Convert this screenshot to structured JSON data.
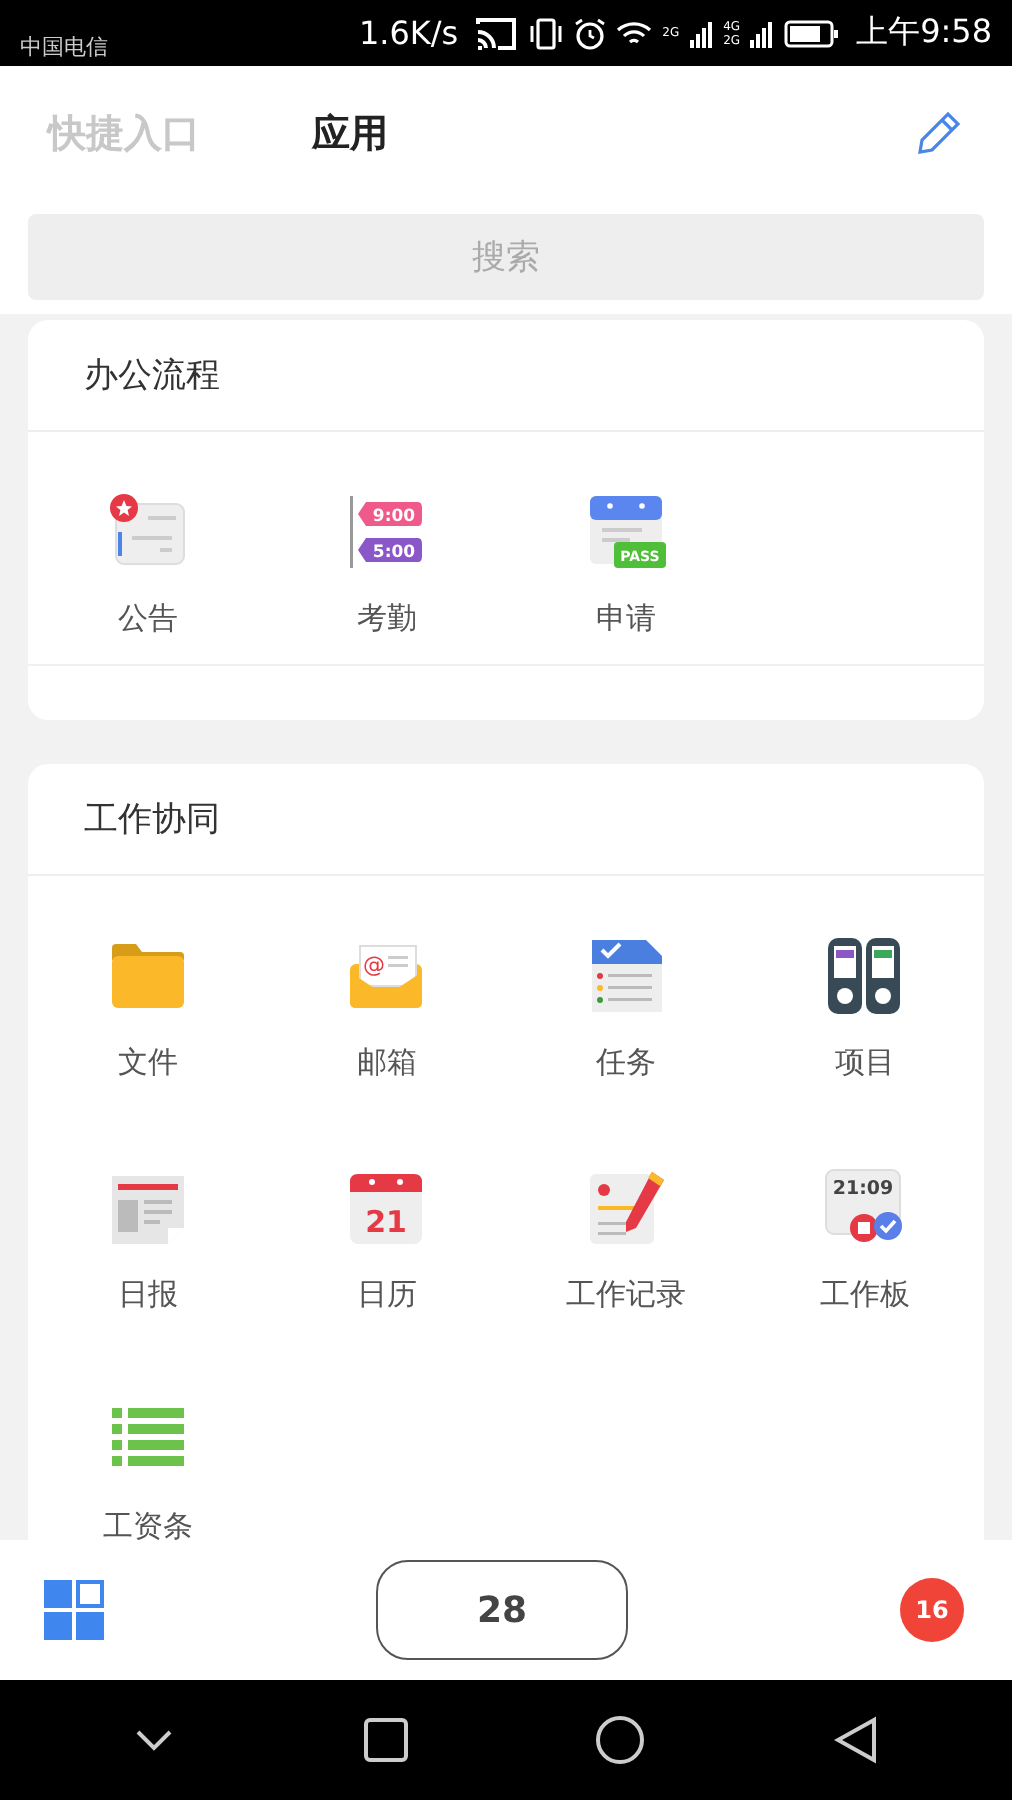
{
  "status_bar": {
    "carrier": "中国电信",
    "speed": "1.6K/s",
    "network_labels": [
      "2G",
      "4G",
      "2G"
    ],
    "time": "上午9:58"
  },
  "tabs": [
    {
      "label": "快捷入口",
      "selected": false
    },
    {
      "label": "应用",
      "selected": true
    }
  ],
  "search": {
    "placeholder": "搜索"
  },
  "sections": [
    {
      "title": "办公流程",
      "apps": [
        {
          "label": "公告",
          "kind": "notice"
        },
        {
          "label": "考勤",
          "kind": "attendance",
          "icon_text": [
            "9:00",
            "5:00"
          ]
        },
        {
          "label": "申请",
          "kind": "apply",
          "icon_text": [
            "PASS"
          ]
        }
      ]
    },
    {
      "title": "工作协同",
      "apps": [
        {
          "label": "文件",
          "kind": "folder"
        },
        {
          "label": "邮箱",
          "kind": "mail",
          "icon_text": [
            "@"
          ]
        },
        {
          "label": "任务",
          "kind": "task"
        },
        {
          "label": "项目",
          "kind": "project"
        },
        {
          "label": "日报",
          "kind": "daily"
        },
        {
          "label": "日历",
          "kind": "calendar",
          "icon_text": [
            "21"
          ]
        },
        {
          "label": "工作记录",
          "kind": "worklog"
        },
        {
          "label": "工作板",
          "kind": "board",
          "icon_text": [
            "21:09"
          ]
        },
        {
          "label": "工资条",
          "kind": "payroll"
        }
      ]
    }
  ],
  "bottom_bar": {
    "count": "28",
    "badge": "16"
  }
}
